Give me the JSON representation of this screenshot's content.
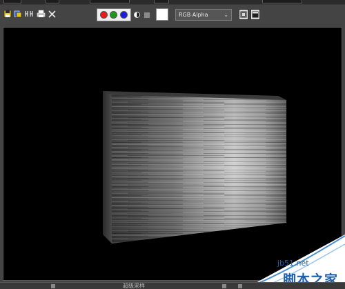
{
  "toolbar": {
    "channel_buttons": [
      {
        "name": "red-channel",
        "color": "#e21b1b"
      },
      {
        "name": "green-channel",
        "color": "#1a9a1a"
      },
      {
        "name": "blue-channel",
        "color": "#1b1bd8"
      }
    ],
    "display_mode": {
      "selected": "RGB Alpha"
    },
    "icons": [
      "save-icon",
      "copy-icon",
      "clone-icon",
      "print-icon",
      "close-icon",
      "monochrome-icon",
      "alpha-icon",
      "background-swatch",
      "split-view-icon",
      "window-icon"
    ]
  },
  "bottom_bar": {
    "label": "超级采样"
  },
  "watermark": {
    "site": "jb51.net",
    "name": "脚本之家"
  },
  "colors": {
    "ui_background": "#444444",
    "viewport_background": "#000000",
    "watermark_blue": "#1e5fa8"
  }
}
